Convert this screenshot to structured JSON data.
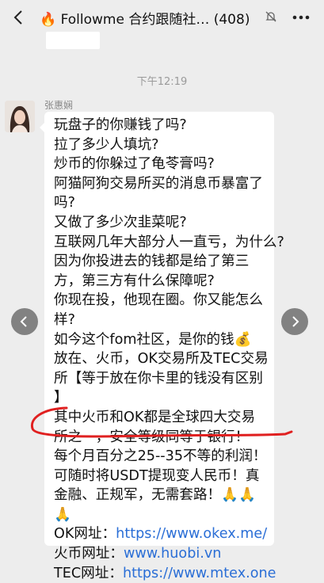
{
  "header": {
    "title": "🔥 Followme 合约跟随社…",
    "count": "(408)"
  },
  "chat": {
    "timestamp": "下午12:19",
    "sender": "张惠娴",
    "lines": [
      "玩盘子的你赚钱了吗?",
      "拉了多少人填坑?",
      "炒币的你躲过了龟苓膏吗?",
      "阿猫阿狗交易所买的消息币暴富了",
      "吗?",
      "又做了多少次韭菜呢?",
      "互联网几年大部分人一直亏，为什么?",
      "因为你投进去的钱都是给了第三",
      "方，第三方有什么保障呢?",
      "你现在投，他现在圈。你又能怎么",
      "样?",
      "如今这个fom社区，是你的钱💰",
      "放在、火币，OK交易所及TEC交易",
      "所【等于放在你卡里的钱没有区别",
      "】",
      "其中火币和OK都是全球四大交易",
      "所之一，安全等级同等于银行！",
      "每个月百分之25--35不等的利润！",
      "可随时将USDT提现变人民币！真",
      "金融、正规军，无需套路！🙏🙏",
      "🙏"
    ],
    "links": [
      {
        "label": "OK网址：",
        "url": "https://www.okex.me/"
      },
      {
        "label": "火币网址：",
        "url": "www.huobi.vn"
      },
      {
        "label": "TEC网址：",
        "url": "https://www.mtex.one"
      }
    ]
  }
}
